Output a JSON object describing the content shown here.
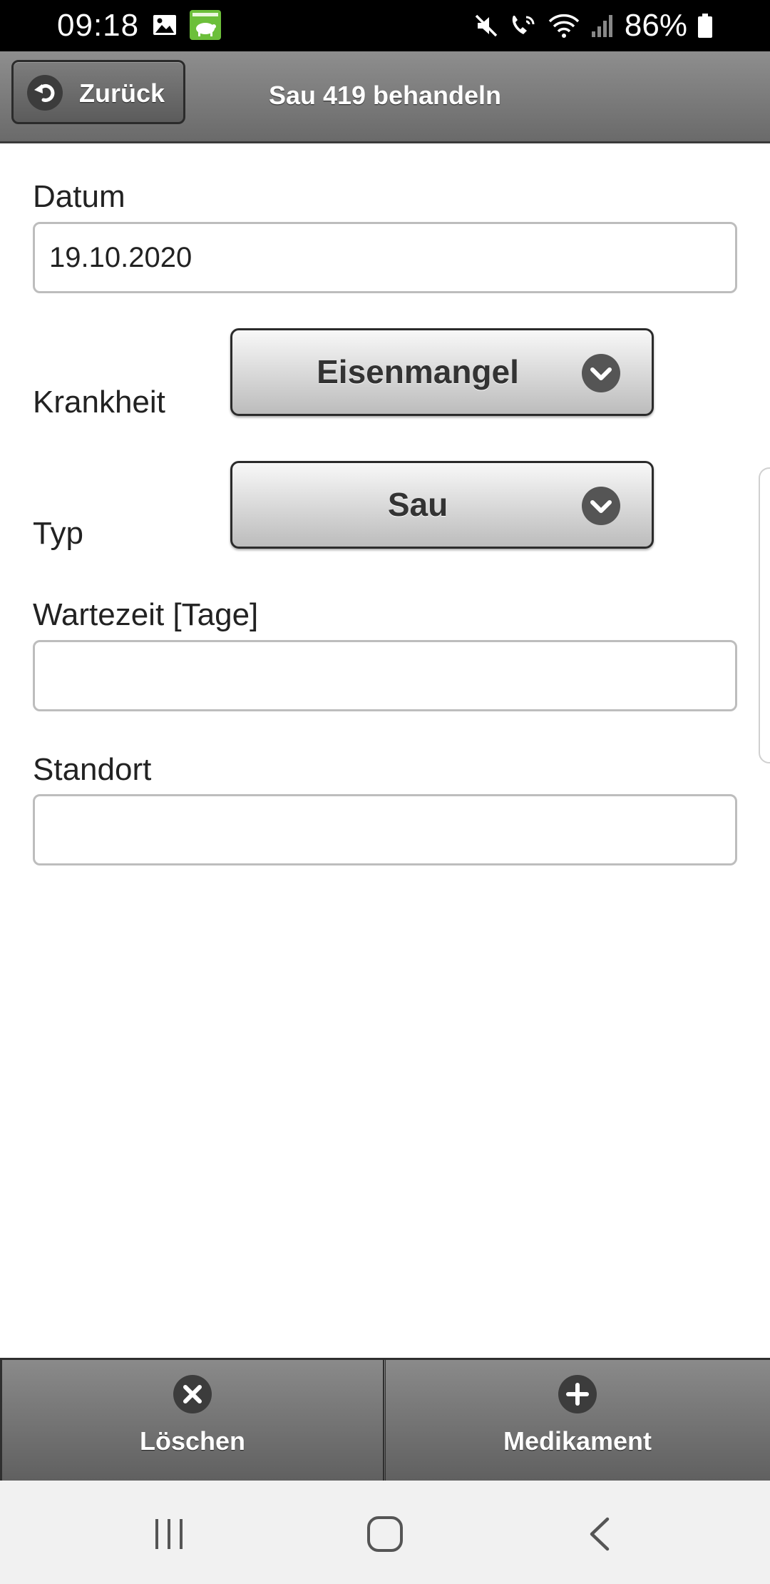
{
  "status_bar": {
    "time": "09:18",
    "battery_percent": "86%",
    "icons": [
      "gallery-icon",
      "app-notification-icon",
      "mute-icon",
      "wifi-calling-icon",
      "wifi-icon",
      "signal-icon",
      "battery-icon"
    ]
  },
  "header": {
    "back_label": "Zurück",
    "title": "Sau 419 behandeln"
  },
  "form": {
    "datum": {
      "label": "Datum",
      "value": "19.10.2020"
    },
    "krankheit": {
      "label": "Krankheit",
      "selected": "Eisenmangel"
    },
    "typ": {
      "label": "Typ",
      "selected": "Sau"
    },
    "wartezeit": {
      "label": "Wartezeit [Tage]",
      "value": ""
    },
    "standort": {
      "label": "Standort",
      "value": ""
    }
  },
  "footer": {
    "delete_label": "Löschen",
    "add_medication_label": "Medikament"
  },
  "colors": {
    "header_bg": "#7a7a7a",
    "footer_bg": "#707070",
    "status_bar_bg": "#000000",
    "app_icon": "#6cbf3a",
    "nav_bar_bg": "#f1f1f1"
  }
}
